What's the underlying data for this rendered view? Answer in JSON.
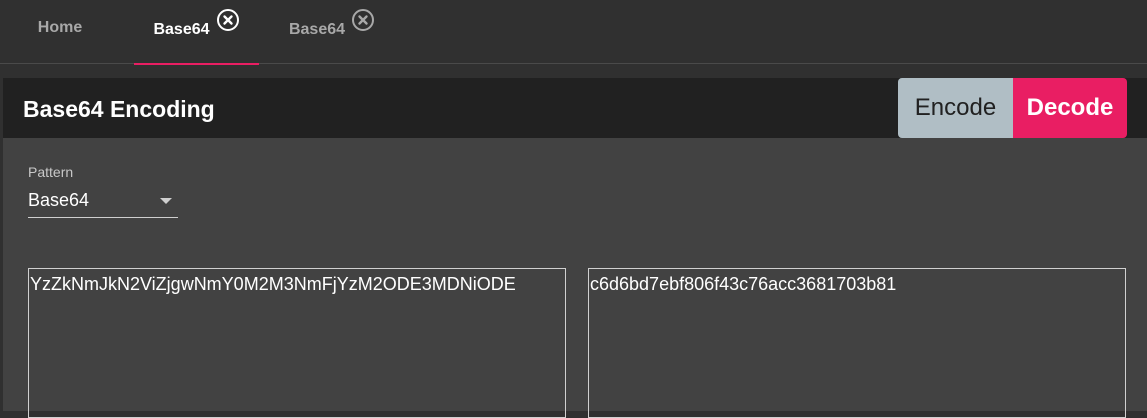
{
  "tabs": [
    {
      "label": "Home",
      "closable": false,
      "active": false
    },
    {
      "label": "Base64",
      "closable": true,
      "active": true
    },
    {
      "label": "Base64",
      "closable": true,
      "active": false
    }
  ],
  "header": {
    "title": "Base64 Encoding",
    "encode_label": "Encode",
    "decode_label": "Decode"
  },
  "pattern": {
    "label": "Pattern",
    "selected": "Base64"
  },
  "input": {
    "value": "YzZkNmJkN2ViZjgwNmY0M2M3NmFjYzM2ODE3MDNiODE"
  },
  "output": {
    "value": "c6d6bd7ebf806f43c76acc3681703b81"
  },
  "colors": {
    "accent": "#e91e63",
    "encode_button": "#b0bec5",
    "header_bg": "#212121",
    "panel_bg": "#424242",
    "page_bg": "#303030"
  },
  "icons": {
    "tab_close": "close-circle-icon",
    "select_caret": "caret-down-icon"
  }
}
